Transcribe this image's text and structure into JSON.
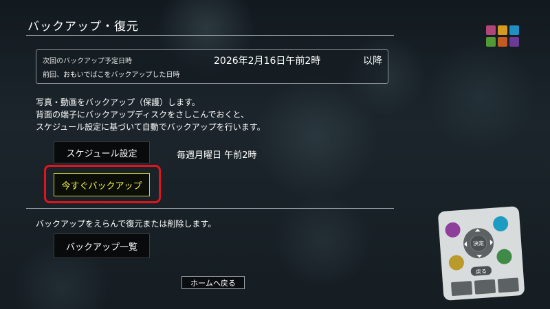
{
  "header": {
    "title": "バックアップ・復元"
  },
  "color_keys": [
    "#b2457a",
    "#d69a1f",
    "#1f8fc4",
    "#4f9a35",
    "#c25a22",
    "#6a3a96"
  ],
  "schedule_info": {
    "next_label": "次回のバックアップ予定日時",
    "last_label": "前回、おもいでばこをバックアップした日時",
    "next_datetime": "2026年2月16日午前2時",
    "next_suffix": "以降"
  },
  "description": {
    "line1": "写真・動画をバックアップ（保護）します。",
    "line2": "背面の端子にバックアップディスクをさしこんでおくと、",
    "line3": "スケジュール設定に基づいて自動でバックアップを行います。"
  },
  "buttons": {
    "schedule": "スケジュール設定",
    "schedule_value": "毎週月曜日 午前2時",
    "backup_now": "今すぐバックアップ",
    "backup_list": "バックアップ一覧",
    "home": "ホームへ戻る"
  },
  "restore_description": "バックアップをえらんで復元または削除します。",
  "remote": {
    "center_label": "決定",
    "back_label": "戻る",
    "colors": [
      "#8e3f9c",
      "#1d9bc3",
      "#b99a2a",
      "#3f8a47"
    ]
  }
}
